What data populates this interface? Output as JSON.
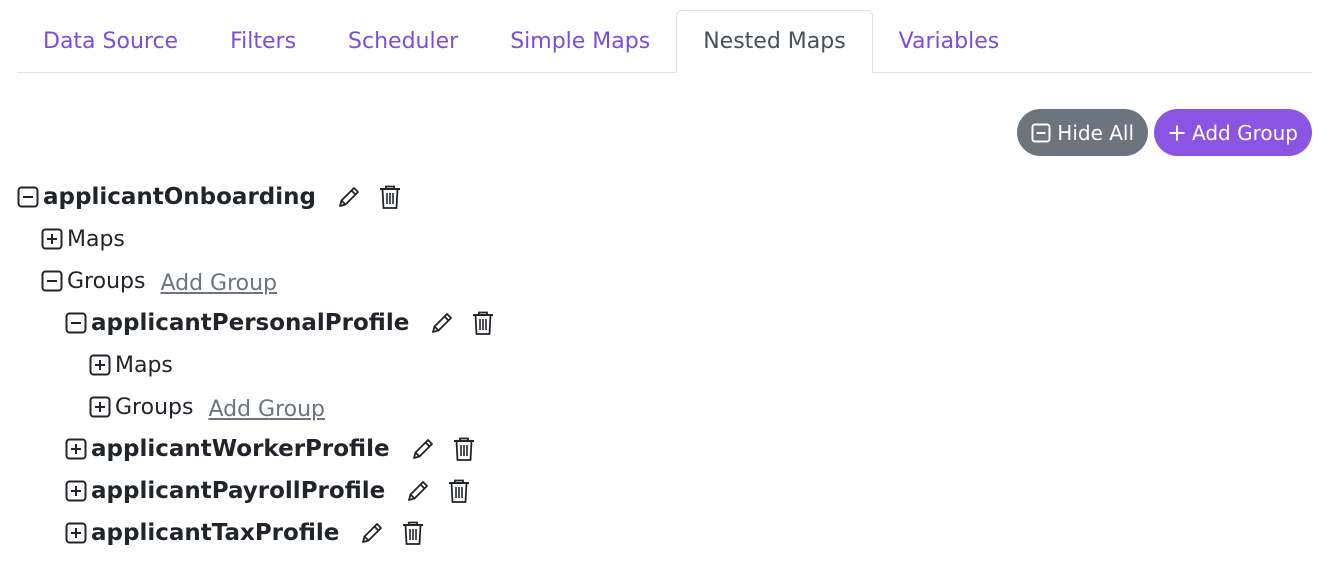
{
  "tabs": [
    {
      "label": "Data Source",
      "active": false
    },
    {
      "label": "Filters",
      "active": false
    },
    {
      "label": "Scheduler",
      "active": false
    },
    {
      "label": "Simple Maps",
      "active": false
    },
    {
      "label": "Nested Maps",
      "active": true
    },
    {
      "label": "Variables",
      "active": false
    }
  ],
  "actions": {
    "hide_all_label": "Hide All",
    "add_group_label": "Add Group"
  },
  "colors": {
    "accent": "#8c54e3",
    "tab_link": "#7c4ddb",
    "secondary_button": "#6c757d"
  },
  "tree": {
    "root": {
      "name": "applicantOnboarding",
      "expanded": true,
      "maps_label": "Maps",
      "groups_label": "Groups",
      "add_group_link": "Add Group"
    },
    "personal": {
      "name": "applicantPersonalProfile",
      "expanded": true,
      "maps_label": "Maps",
      "groups_label": "Groups",
      "add_group_link": "Add Group"
    },
    "worker": {
      "name": "applicantWorkerProfile",
      "expanded": false
    },
    "payroll": {
      "name": "applicantPayrollProfile",
      "expanded": false
    },
    "tax": {
      "name": "applicantTaxProfile",
      "expanded": false
    }
  }
}
